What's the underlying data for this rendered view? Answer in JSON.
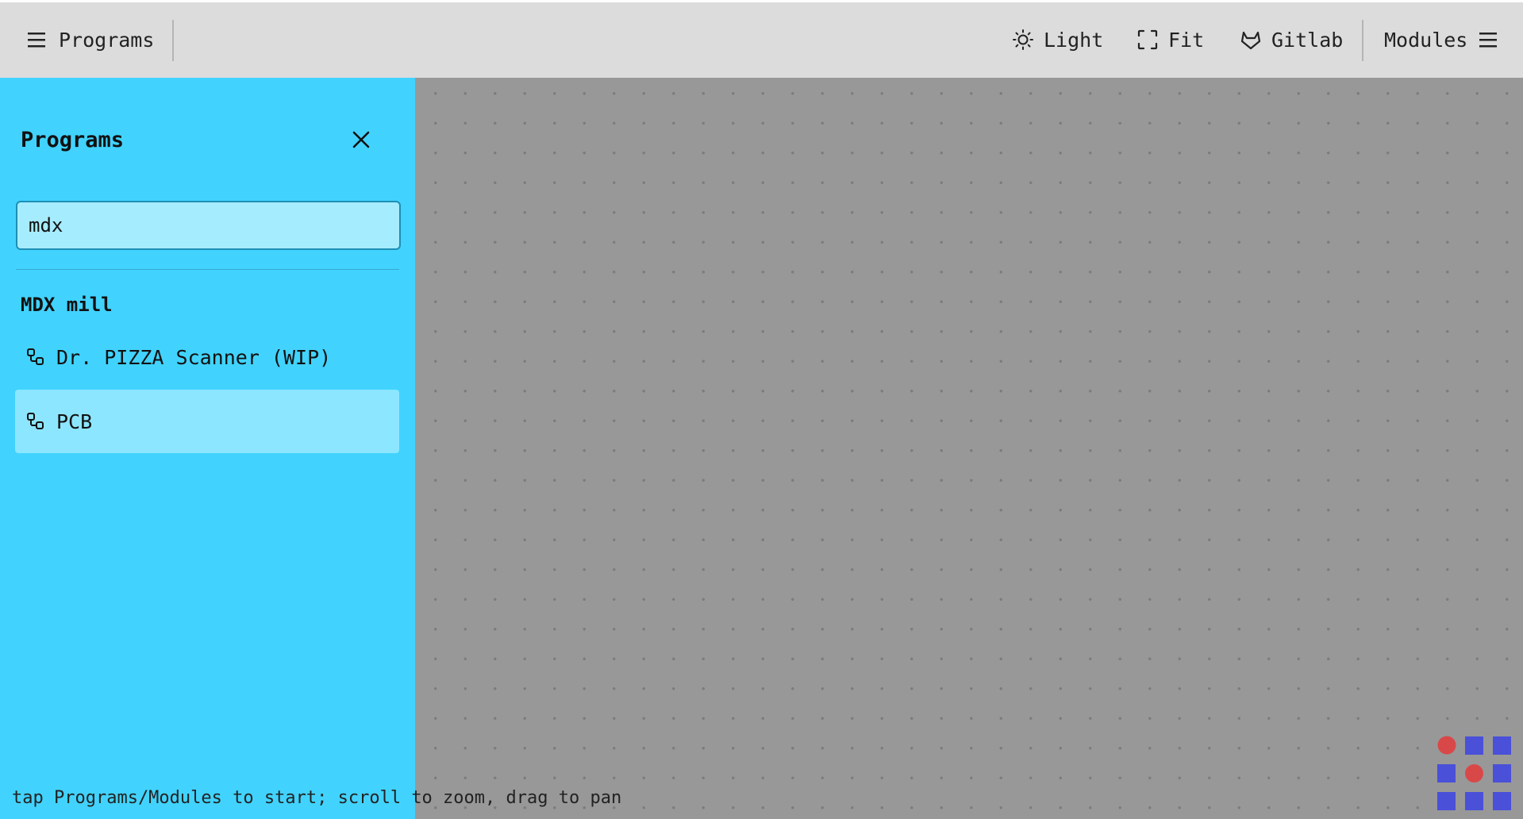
{
  "topbar": {
    "programs_label": "Programs",
    "light_label": "Light",
    "fit_label": "Fit",
    "gitlab_label": "Gitlab",
    "modules_label": "Modules"
  },
  "sidebar": {
    "title": "Programs",
    "search": {
      "value": "mdx",
      "placeholder": ""
    },
    "groups": [
      {
        "title": "MDX mill",
        "items": [
          {
            "label": "Dr. PIZZA Scanner (WIP)",
            "icon": "program-icon",
            "selected": false
          },
          {
            "label": "PCB",
            "icon": "program-icon",
            "selected": true
          }
        ]
      }
    ],
    "background_color": "#41d3fe",
    "selected_item_color": "#8de6ff"
  },
  "status_text": "tap Programs/Modules to start; scroll to zoom, drag to pan",
  "colors": {
    "canvas": "#989898",
    "topbar": "#dcdcdc",
    "logo_red": "#d94848",
    "logo_blue": "#4a50d8"
  }
}
